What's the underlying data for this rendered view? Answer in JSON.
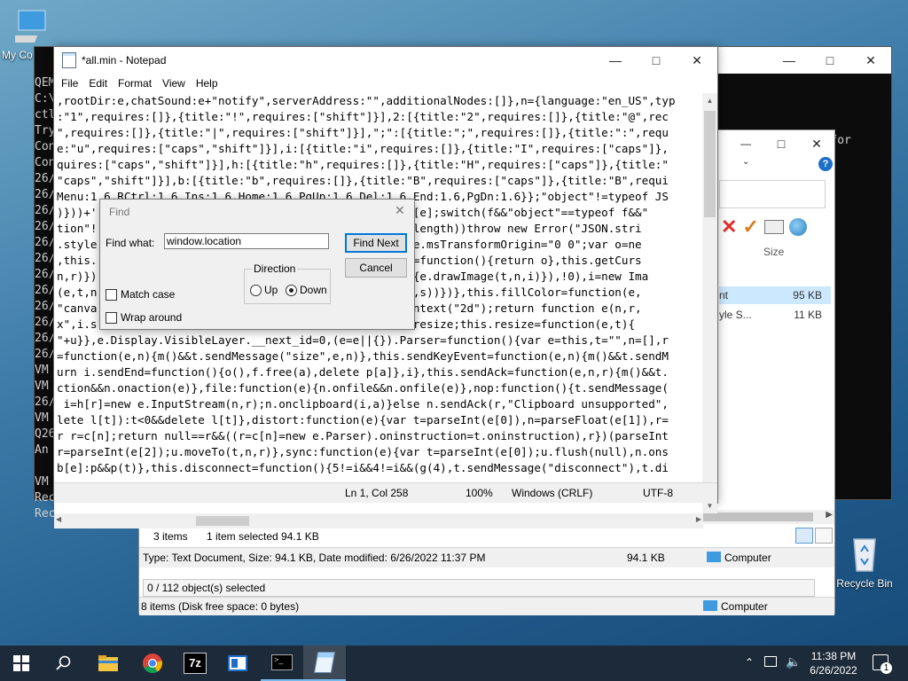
{
  "desktop": {
    "this_pc_label": "My Co",
    "recycle_bin_label": "Recycle Bin"
  },
  "console": {
    "left_column": [
      "QEM",
      "C:\\",
      "ctl",
      "Try",
      "Con",
      "Con",
      "26/",
      "26/",
      "26/",
      "26/",
      "26/",
      "26/",
      "26/",
      "26/",
      "26/",
      "26/",
      "26/",
      "26/",
      "VM",
      "VM",
      "26/",
      "VM",
      "Q26",
      "An",
      "",
      "VM",
      "Rec",
      "Rec"
    ],
    "right_text": ": QEMU waiting for conne"
  },
  "explorer": {
    "col_size": "Size",
    "row1_name": "nt",
    "row1_size": "95 KB",
    "row2_name": "yle S...",
    "row2_size": "11 KB",
    "items_count": "3 items",
    "selected_info": "1 item selected  94.1 KB",
    "details": "Type: Text Document, Size: 94.1 KB, Date modified: 6/26/2022 11:37 PM",
    "details_size": "94.1 KB",
    "details_location": "Computer",
    "objects_selected": "0 / 112 object(s) selected",
    "disk_info": "8 items (Disk free space: 0 bytes)",
    "disk_location": "Computer"
  },
  "notepad": {
    "title": "*all.min - Notepad",
    "menu": [
      "File",
      "Edit",
      "Format",
      "View",
      "Help"
    ],
    "lines": [
      ",rootDir:e,chatSound:e+\"notify\",serverAddress:\"\",additionalNodes:[]},n={language:\"en_US\",typ",
      ":\"1\",requires:[]},{title:\"!\",requires:[\"shift\"]}],2:[{title:\"2\",requires:[]},{title:\"@\",rec",
      "\",requires:[]},{title:\"|\",requires:[\"shift\"]}],\";\":[{title:\";\",requires:[]},{title:\":\",requ",
      "e:\"u\",requires:[\"caps\",\"shift\"]}],i:[{title:\"i\",requires:[]},{title:\"I\",requires:[\"caps\"]},",
      "quires:[\"caps\",\"shift\"]}],h:[{title:\"h\",requires:[]},{title:\"H\",requires:[\"caps\"]},{title:\"",
      "\"caps\",\"shift\"]}],b:[{title:\"b\",requires:[]},{title:\"B\",requires:[\"caps\"]},{title:\"B\",requi",
      "Menu:1.6,RCtrl:1.6,Ins:1.6,Home:1.6,PgUp:1.6,Del:1.6,End:1.6,PgDn:1.6}};\"object\"!=typeof JS",
      ")}))+'                                        e,r,f=t[e];switch(f&&\"object\"==typeof f&&\"",
      "tion\"!                                        peof t.length))throw new Error(\"JSON.stri",
      ".style                                        =i.style.msTransformOrigin=\"0 0\";var o=ne",
      ",this.                                        ltLayer=function(){return o},this.getCurs",
      "n,r)})                                        ction(){e.drawImage(t,n,i)}),!0),i=new Ima",
      "(e,t,n                                        r,a,i,o,s))})},this.fillColor=function(e,",
      "\"canva                                        e.getContext(\"2d\");return function e(n,r,",
      "x\",i.s                                        o=this.resize;this.resize=function(e,t){",
      "\"+u}},e.Display.VisibleLayer.__next_id=0,(e=e||{}).Parser=function(){var e=this,t=\"\",n=[],r",
      "=function(e,n){m()&&t.sendMessage(\"size\",e,n)},this.sendKeyEvent=function(e,n){m()&&t.sendM",
      "urn i.sendEnd=function(){o(),f.free(a),delete p[a]},i},this.sendAck=function(e,n,r){m()&&t.",
      "ction&&n.onaction(e)},file:function(e){n.onfile&&n.onfile(e)},nop:function(){t.sendMessage(",
      " i=h[r]=new e.InputStream(n,r);n.onclipboard(i,a)}else n.sendAck(r,\"Clipboard unsupported\",",
      "lete l[t]):t<0&&delete l[t]},distort:function(e){var t=parseInt(e[0]),n=parseFloat(e[1]),r=",
      "r r=c[n];return null==r&&((r=c[n]=new e.Parser).oninstruction=t.oninstruction),r})(parseInt",
      "r=parseInt(e[2]);u.moveTo(t,n,r)},sync:function(e){var t=parseInt(e[0]);u.flush(null),n.ons",
      "b[e]:p&&p(t)},this.disconnect=function(){5!=i&&4!=i&&(g(4),t.sendMessage(\"disconnect\"),t.di"
    ],
    "status": {
      "position": "Ln 1, Col 258",
      "zoom": "100%",
      "line_ending": "Windows (CRLF)",
      "encoding": "UTF-8"
    }
  },
  "find_dialog": {
    "title": "Find",
    "find_what_label": "Find what:",
    "find_what_value": "window.location",
    "find_next_label": "Find Next",
    "cancel_label": "Cancel",
    "direction_label": "Direction",
    "up_label": "Up",
    "down_label": "Down",
    "match_case_label": "Match case",
    "wrap_around_label": "Wrap around"
  },
  "taskbar": {
    "time": "11:38 PM",
    "date": "6/26/2022",
    "notification_count": "1",
    "sevenzip_label": "7z"
  }
}
